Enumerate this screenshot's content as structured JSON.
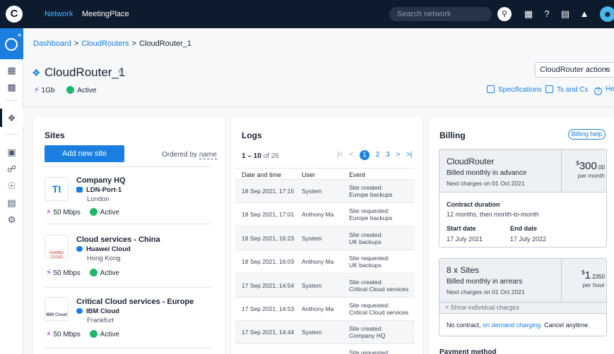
{
  "topbar": {
    "logo": "C",
    "nav": [
      "Network",
      "MeetingPlace"
    ],
    "search_placeholder": "Search network"
  },
  "breadcrumb": {
    "items": [
      "Dashboard",
      "CloudRouters",
      "CloudRouter_1"
    ]
  },
  "header": {
    "title": "CloudRouter_1",
    "speed": "1Gb",
    "status": "Active",
    "actions_label": "CloudRouter actions",
    "links": [
      "Specifications",
      "Ts and Cs",
      "He"
    ]
  },
  "sites": {
    "title": "Sites",
    "add_button": "Add new site",
    "ordered_prefix": "Ordered by",
    "ordered_key": "name",
    "items": [
      {
        "name": "Company HQ",
        "provider": "LDN-Port-1",
        "location": "London",
        "speed": "50 Mbps",
        "status": "Active",
        "logo": "TI"
      },
      {
        "name": "Cloud services - China",
        "provider": "Huawei Cloud",
        "location": "Hong Kong",
        "speed": "50 Mbps",
        "status": "Active",
        "logo": "HUAWEI CLOUD"
      },
      {
        "name": "Critical Cloud services - Europe",
        "provider": "IBM Cloud",
        "location": "Frankfurt",
        "speed": "50 Mbps",
        "status": "Active",
        "logo": "IBM Cloud"
      }
    ]
  },
  "logs": {
    "title": "Logs",
    "range_prefix": "1 – 10",
    "range_suffix": "of 26",
    "pages": [
      "1",
      "2",
      "3"
    ],
    "columns": [
      "Date and time",
      "User",
      "Event"
    ],
    "rows": [
      {
        "date": "18 Sep 2021, 17:15",
        "user": "System",
        "event1": "Site created:",
        "event2": "Europe backups"
      },
      {
        "date": "18 Sep 2021, 17:01",
        "user": "Anthony Ma",
        "event1": "Site requested:",
        "event2": "Europe backups"
      },
      {
        "date": "18 Sep 2021, 16:23",
        "user": "System",
        "event1": "Site created:",
        "event2": "UK backups"
      },
      {
        "date": "18 Sep 2021, 16:03",
        "user": "Anthony Ma",
        "event1": "Site requested:",
        "event2": "UK backups"
      },
      {
        "date": "17 Sep 2021, 14:54",
        "user": "System",
        "event1": "Site created:",
        "event2": "Critical Cloud services"
      },
      {
        "date": "17 Sep 2021, 14:53",
        "user": "Anthony Ma",
        "event1": "Site requested:",
        "event2": "Critical Cloud services"
      },
      {
        "date": "17 Sep 2021, 14:44",
        "user": "System",
        "event1": "Site created:",
        "event2": "Company HQ"
      },
      {
        "date": "17 Sep 2021, 14:43",
        "user": "Anthony Ma",
        "event1": "Site requested:",
        "event2": ""
      }
    ]
  },
  "billing": {
    "title": "Billing",
    "help": "Billing help",
    "router": {
      "name": "CloudRouter",
      "billed": "Billed monthly in advance",
      "next": "Next charges on 01 Oct 2021",
      "currency": "$",
      "amount": "300",
      "decimals": ".00",
      "period": "per month",
      "duration_label": "Contract duration",
      "duration_value": "12 months, then month-to-month",
      "start_label": "Start date",
      "start_value": "17 July 2021",
      "end_label": "End date",
      "end_value": "17 July 2022"
    },
    "sites": {
      "name": "8 x Sites",
      "billed": "Billed monthly in arrears",
      "next": "Next charges on 01 Oct 2021",
      "currency": "$",
      "amount": "1",
      "decimals": ".2350",
      "period": "per hour",
      "show_charges": "+ Show individual charges",
      "note_prefix": "No contract,",
      "note_link": "on demand charging.",
      "note_suffix": "Cancel anytime."
    },
    "payment_title": "Payment method"
  }
}
